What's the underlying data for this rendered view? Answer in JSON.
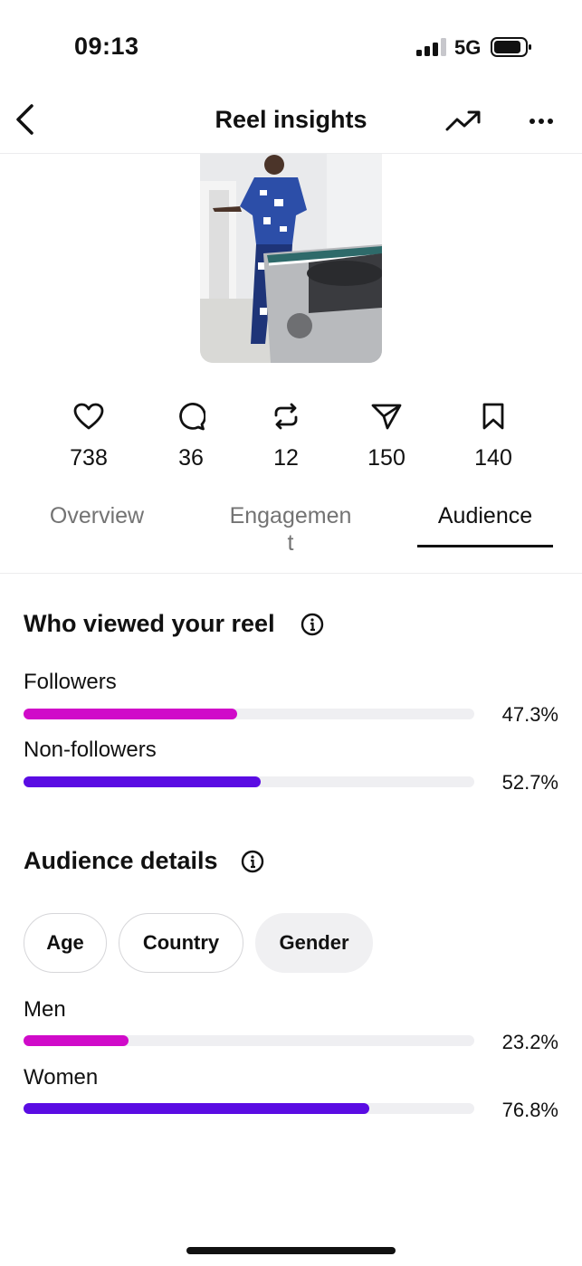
{
  "status_bar": {
    "time": "09:13",
    "network": "5G",
    "signal_bars_active": 3,
    "battery_level": 0.8
  },
  "header": {
    "title": "Reel insights",
    "back_icon": "chevron-left-icon",
    "trend_icon": "trending-up-icon",
    "more_icon": "more-horizontal-icon"
  },
  "metrics": [
    {
      "icon": "heart-icon",
      "value": "738"
    },
    {
      "icon": "comment-icon",
      "value": "36"
    },
    {
      "icon": "repost-icon",
      "value": "12"
    },
    {
      "icon": "share-icon",
      "value": "150"
    },
    {
      "icon": "bookmark-icon",
      "value": "140"
    }
  ],
  "tabs": [
    {
      "label": "Overview",
      "active": false
    },
    {
      "label": "Engagemen",
      "label_wrap": "t",
      "active": false
    },
    {
      "label": "Audience",
      "active": true
    }
  ],
  "viewers": {
    "title": "Who viewed your reel",
    "rows": [
      {
        "label": "Followers",
        "percent_text": "47.3%",
        "fraction": 0.473,
        "color": "#d00bc9"
      },
      {
        "label": "Non-followers",
        "percent_text": "52.7%",
        "fraction": 0.527,
        "color": "#5a0ce3"
      }
    ]
  },
  "audience": {
    "title": "Audience details",
    "chips": [
      {
        "label": "Age",
        "selected": false
      },
      {
        "label": "Country",
        "selected": false
      },
      {
        "label": "Gender",
        "selected": true
      }
    ],
    "rows": [
      {
        "label": "Men",
        "percent_text": "23.2%",
        "fraction": 0.232,
        "color": "#d00bc9"
      },
      {
        "label": "Women",
        "percent_text": "76.8%",
        "fraction": 0.768,
        "color": "#5a0ce3"
      }
    ]
  }
}
